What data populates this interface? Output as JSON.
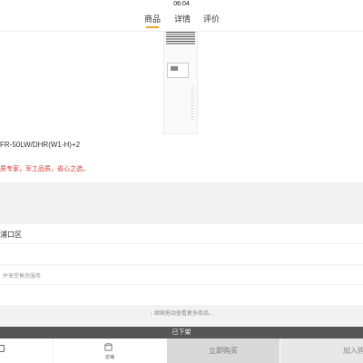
{
  "status_bar": {
    "time": "06:04"
  },
  "tabs": [
    {
      "label": "商品",
      "active": true
    },
    {
      "label": "详情",
      "active": false
    },
    {
      "label": "评价",
      "active": false
    }
  ],
  "product": {
    "title_fragment": "FR-50LW/DHR(W1-H)+2",
    "slogan_fragment": "质专家，军工品质，省心之选。"
  },
  "location": {
    "text_fragment": "浦口区"
  },
  "service": {
    "text_fragment": "并享受售后服务"
  },
  "more_hint": "↓ 继续拖动查看更多商品...",
  "status_banner": "已下架",
  "bottom_bar": {
    "shop_label": "店铺",
    "buy_now_label": "立即购买",
    "add_cart_label": "加入购"
  },
  "colors": {
    "accent": "#f0a823",
    "slogan_red": "#e0362c",
    "banner_bg": "#555555"
  }
}
